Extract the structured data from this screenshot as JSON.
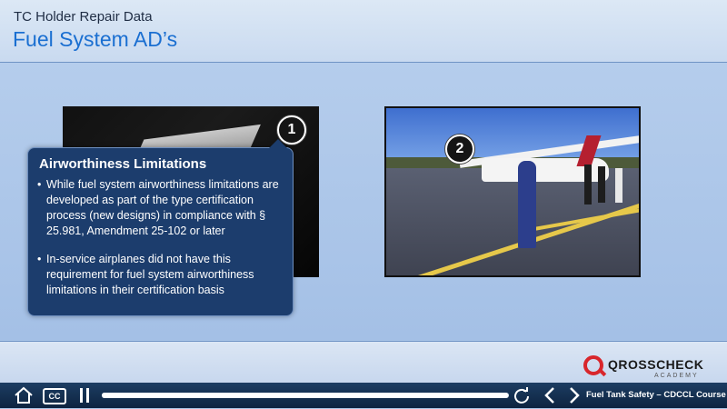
{
  "header": {
    "subtitle": "TC Holder Repair Data",
    "title": "Fuel System AD’s"
  },
  "markers": [
    "1",
    "2"
  ],
  "callout": {
    "heading": "Airworthiness Limitations",
    "bullets": [
      "While fuel system airworthiness limitations are developed as part of the type certification process (new designs) in compliance with § 25.981, Amendment 25-102 or later",
      "In-service airplanes did not have this requirement for fuel system airworthiness limitations in their certification basis"
    ]
  },
  "logo": {
    "name": "QROSSCHECK",
    "sub": "ACADEMY"
  },
  "player": {
    "cc_label": "CC",
    "progress": 0.998,
    "course_title": "Fuel Tank Safety – CDCCL Course",
    "prev_icon": "chevron-left-icon",
    "next_icon": "chevron-right-icon",
    "home_icon": "home-icon",
    "replay_icon": "replay-icon",
    "pause_icon": "pause-icon"
  },
  "colors": {
    "title": "#1a6fd1",
    "callout_bg": "#1c3d6d",
    "player_bg": "#0e2440",
    "brand_red": "#d8262c"
  }
}
